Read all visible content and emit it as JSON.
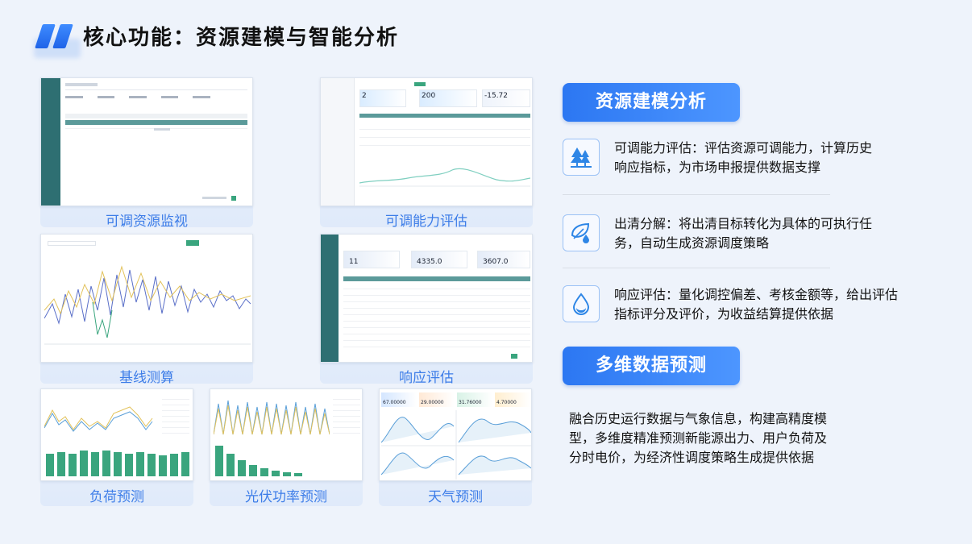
{
  "header": {
    "title": "核心功能：资源建模与智能分析"
  },
  "screenshots": [
    {
      "caption": "可调资源监视"
    },
    {
      "caption": "可调能力评估"
    },
    {
      "caption": "基线测算"
    },
    {
      "caption": "响应评估"
    },
    {
      "caption": "负荷预测"
    },
    {
      "caption": "光伏功率预测"
    },
    {
      "caption": "天气预测"
    }
  ],
  "thumb_text": {
    "capacity_cards": [
      "2",
      "200",
      "-15.72"
    ],
    "response_cards": [
      "11",
      "4335.0",
      "3607.0"
    ],
    "weather_cards": [
      "67.00000",
      "29.00000",
      "31.76000",
      "4.70000"
    ]
  },
  "section1": {
    "label": "资源建模分析",
    "features": [
      {
        "icon": "tree-icon",
        "text": "可调能力评估：评估资源可调能力，计算历史响应指标，为市场申报提供数据支撑"
      },
      {
        "icon": "leaf-drop-icon",
        "text": "出清分解：将出清目标转化为具体的可执行任务，自动生成资源调度策略"
      },
      {
        "icon": "water-drop-icon",
        "text": "响应评估：量化调控偏差、考核金额等，给出评估指标评分及评价，为收益结算提供依据"
      }
    ]
  },
  "section2": {
    "label": "多维数据预测",
    "text": "融合历史运行数据与气象信息，构建高精度模型，多维度精准预测新能源出力、用户负荷及分时电价，为经济性调度策略生成提供依据"
  },
  "colors": {
    "accent": "#3d7de8",
    "brand": "#2c77f2",
    "sidebar": "#2e6f72",
    "series_blue": "#5a6fc8",
    "series_yellow": "#e2c25a",
    "series_green": "#3aa57e"
  }
}
